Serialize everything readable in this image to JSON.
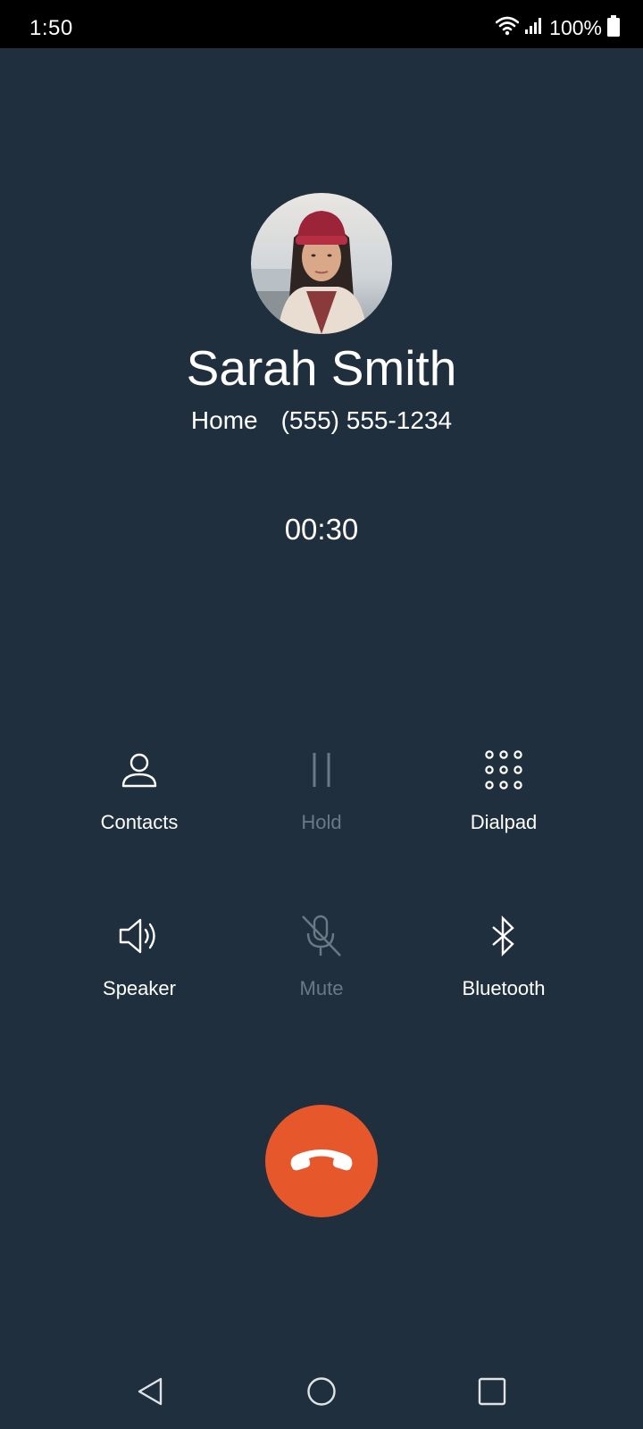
{
  "status_bar": {
    "time": "1:50",
    "battery_text": "100%",
    "icons": [
      "wifi-icon",
      "signal-icon",
      "battery-icon"
    ]
  },
  "caller": {
    "name": "Sarah Smith",
    "number_type": "Home",
    "number": "(555) 555-1234",
    "avatar": "contact-photo"
  },
  "call": {
    "timer": "00:30"
  },
  "controls": [
    {
      "label": "Contacts",
      "icon": "person-icon",
      "enabled": true
    },
    {
      "label": "Hold",
      "icon": "pause-icon",
      "enabled": false
    },
    {
      "label": "Dialpad",
      "icon": "dialpad-icon",
      "enabled": true
    },
    {
      "label": "Speaker",
      "icon": "speaker-icon",
      "enabled": true
    },
    {
      "label": "Mute",
      "icon": "mic-off-icon",
      "enabled": false
    },
    {
      "label": "Bluetooth",
      "icon": "bluetooth-icon",
      "enabled": true
    }
  ],
  "end_call": {
    "icon": "phone-hangup-icon",
    "color": "#e6582c"
  },
  "nav": {
    "icons": [
      "back-icon",
      "home-icon",
      "recents-icon"
    ]
  },
  "colors": {
    "background": "#1f2f3d",
    "disabled": "#6a7984",
    "end_call": "#e6582c"
  }
}
